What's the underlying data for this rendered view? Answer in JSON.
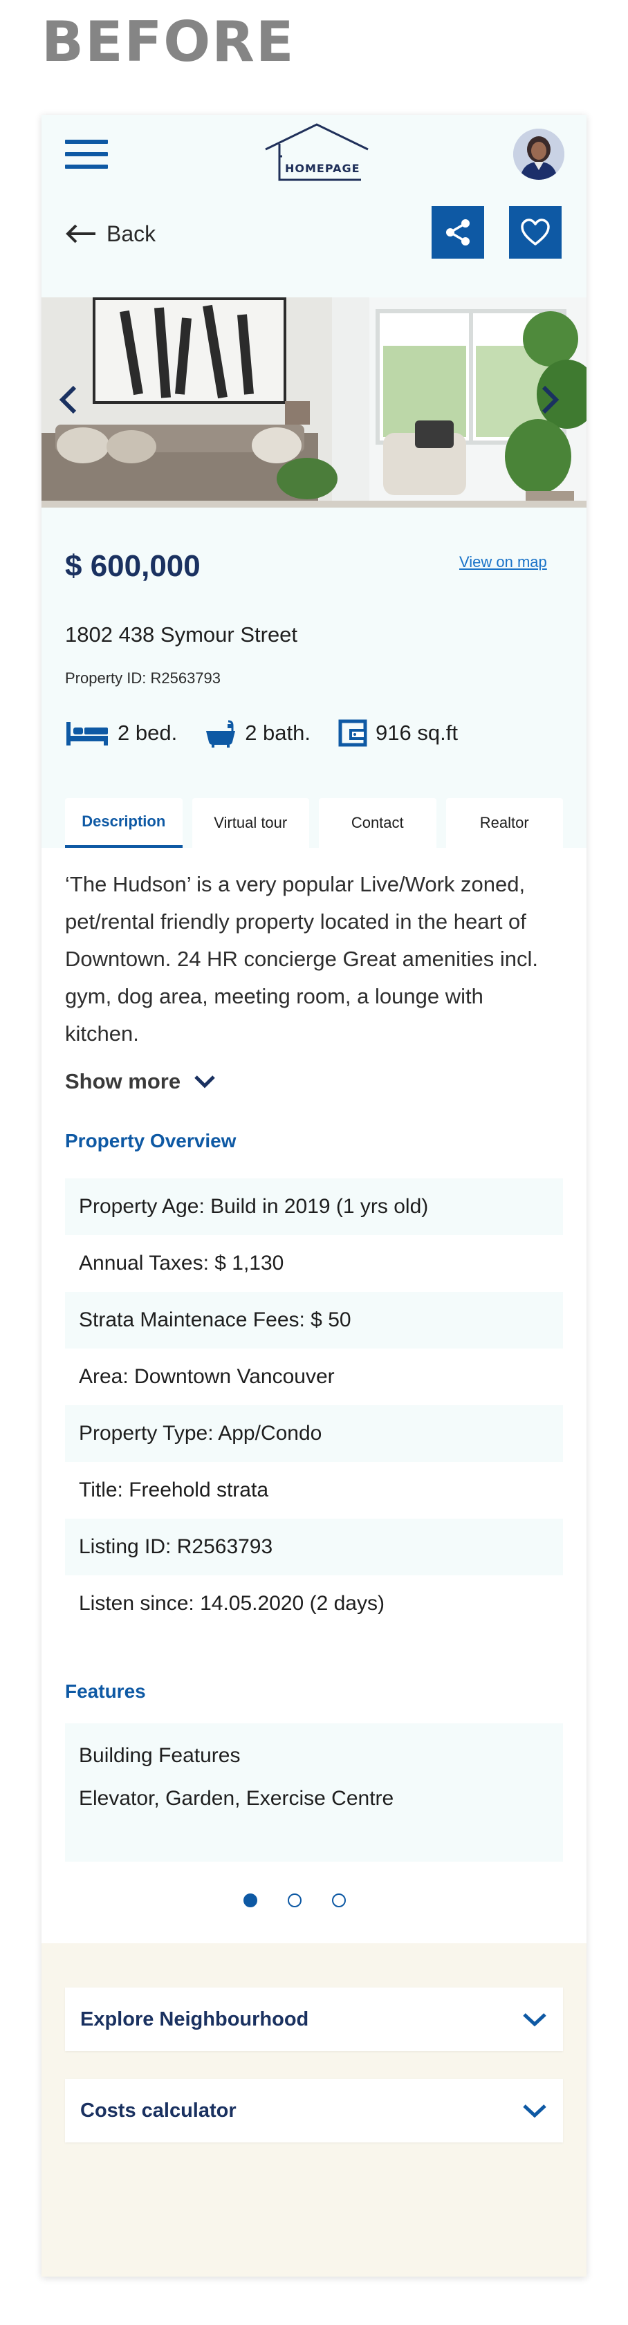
{
  "heading": "BEFORE",
  "header": {
    "logo_text": "HOMEPAGE",
    "back_label": "Back"
  },
  "listing": {
    "price": "$ 600,000",
    "map_link": "View on map",
    "address": "1802 438 Symour Street",
    "property_id": "Property ID: R2563793",
    "specs": {
      "beds": "2 bed.",
      "baths": "2 bath.",
      "area": "916 sq.ft"
    }
  },
  "tabs": [
    {
      "label": "Description",
      "active": true
    },
    {
      "label": "Virtual tour",
      "active": false
    },
    {
      "label": "Contact",
      "active": false
    },
    {
      "label": "Realtor",
      "active": false
    }
  ],
  "description": {
    "text": "‘The Hudson’ is a very popular Live/Work zoned, pet/rental friendly property located in the heart of Downtown. 24 HR concierge Great amenities incl. gym, dog area, meeting room, a lounge with kitchen.",
    "show_more": "Show more"
  },
  "overview": {
    "title": "Property Overview",
    "rows": [
      "Property Age: Build in 2019 (1 yrs old)",
      "Annual Taxes: $ 1,130",
      "Strata Maintenace Fees: $ 50",
      "Area: Downtown Vancouver",
      "Property Type: App/Condo",
      "Title: Freehold strata",
      "Listing ID: R2563793",
      "Listen since: 14.05.2020 (2 days)"
    ]
  },
  "features": {
    "title": "Features",
    "heading": "Building Features",
    "value": "Elevator, Garden, Exercise Centre",
    "pagination": {
      "total": 3,
      "active": 1
    }
  },
  "accordions": {
    "neighbourhood": "Explore Neighbourhood",
    "calculator": "Costs calculator"
  },
  "colors": {
    "primary": "#0e59a4",
    "navy": "#1a3160",
    "light_bg": "#f4fbfb",
    "cream_bg": "#f9f6ec"
  },
  "icons": [
    "menu-icon",
    "house-logo-icon",
    "back-arrow-icon",
    "share-icon",
    "heart-icon",
    "chevron-left-icon",
    "chevron-right-icon",
    "bed-icon",
    "bath-icon",
    "area-icon",
    "chevron-down-icon"
  ]
}
